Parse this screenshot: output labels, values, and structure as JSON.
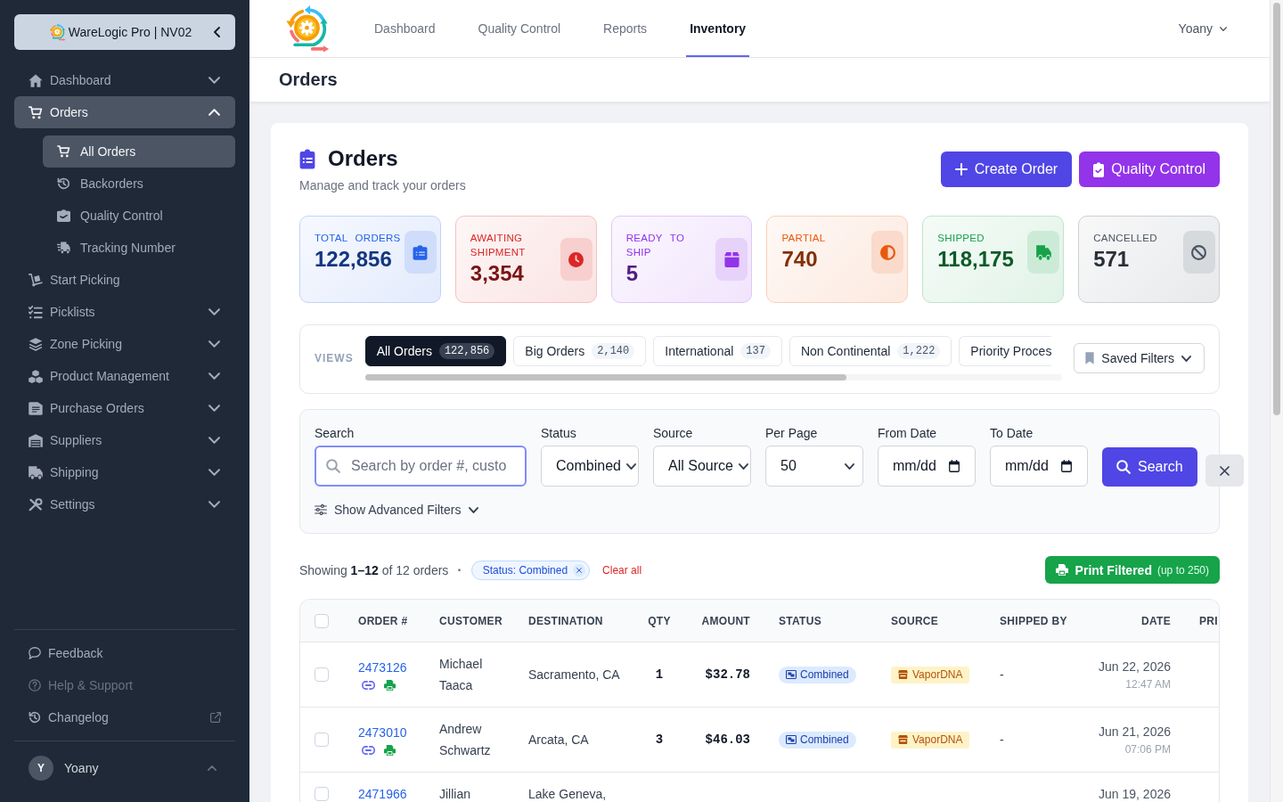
{
  "sidebar": {
    "brand": "WareLogic Pro | NV02",
    "items": [
      {
        "kind": "group",
        "label": "Dashboard",
        "selected": false,
        "expanded": false
      },
      {
        "kind": "group",
        "label": "Orders",
        "selected": true,
        "expanded": true,
        "children": [
          {
            "label": "All Orders",
            "selected": true
          },
          {
            "label": "Backorders",
            "selected": false
          },
          {
            "label": "Quality Control",
            "selected": false
          },
          {
            "label": "Tracking Number",
            "selected": false
          }
        ]
      },
      {
        "kind": "link",
        "label": "Start Picking",
        "selected": false
      },
      {
        "kind": "group",
        "label": "Picklists",
        "selected": false,
        "expanded": false
      },
      {
        "kind": "group",
        "label": "Zone Picking",
        "selected": false,
        "expanded": false
      },
      {
        "kind": "group",
        "label": "Product Management",
        "selected": false,
        "expanded": false
      },
      {
        "kind": "group",
        "label": "Purchase Orders",
        "selected": false,
        "expanded": false
      },
      {
        "kind": "group",
        "label": "Suppliers",
        "selected": false,
        "expanded": false
      },
      {
        "kind": "group",
        "label": "Shipping",
        "selected": false,
        "expanded": false
      },
      {
        "kind": "group",
        "label": "Settings",
        "selected": false,
        "expanded": false
      }
    ],
    "footer_items": [
      {
        "label": "Feedback",
        "disabled": false,
        "external": false
      },
      {
        "label": "Help & Support",
        "disabled": true,
        "external": false
      },
      {
        "label": "Changelog",
        "disabled": false,
        "external": true
      }
    ],
    "user": {
      "initial": "Y",
      "name": "Yoany"
    }
  },
  "top_nav": {
    "links": [
      {
        "label": "Dashboard",
        "selected": false
      },
      {
        "label": "Quality Control",
        "selected": false
      },
      {
        "label": "Reports",
        "selected": false
      },
      {
        "label": "Inventory",
        "selected": true
      }
    ],
    "user": "Yoany"
  },
  "page_title": "Orders",
  "header": {
    "title": "Orders",
    "subtitle": "Manage and track your orders",
    "buttons": [
      {
        "kind": "primary",
        "label": "Create Order"
      },
      {
        "kind": "secondary",
        "label": "Quality Control"
      }
    ]
  },
  "stats": [
    {
      "label": "TOTAL ORDERS",
      "value": "122,856",
      "color": "#2563eb"
    },
    {
      "label": "AWAITING SHIPMENT",
      "value": "3,354",
      "color": "#dc2626"
    },
    {
      "label": "READY TO SHIP",
      "value": "5",
      "color": "#9333ea"
    },
    {
      "label": "PARTIAL",
      "value": "740",
      "color": "#ea580c"
    },
    {
      "label": "SHIPPED",
      "value": "118,175",
      "color": "#16a34a"
    },
    {
      "label": "CANCELLED",
      "value": "571",
      "color": "#4b5563"
    }
  ],
  "views": {
    "label": "VIEWS",
    "tabs": [
      {
        "label": "All Orders",
        "count": "122,856",
        "selected": true
      },
      {
        "label": "Big Orders",
        "count": "2,140",
        "selected": false
      },
      {
        "label": "International",
        "count": "137",
        "selected": false
      },
      {
        "label": "Non Continental",
        "count": "1,222",
        "selected": false
      },
      {
        "label": "Priority Proces",
        "selected": false
      }
    ],
    "saved_filters": "Saved Filters"
  },
  "filters": {
    "fields": [
      {
        "kind": "search",
        "label": "Search",
        "placeholder": "Search by order #, custo",
        "focused": true
      },
      {
        "kind": "select",
        "label": "Status",
        "value": "Combined"
      },
      {
        "kind": "select",
        "label": "Source",
        "value": "All Source"
      },
      {
        "kind": "select",
        "label": "Per Page",
        "value": "50"
      },
      {
        "kind": "date",
        "label": "From Date",
        "placeholder": "mm/dd"
      },
      {
        "kind": "date",
        "label": "To Date",
        "placeholder": "mm/dd"
      }
    ],
    "search_button": "Search",
    "advanced_toggle": "Show Advanced Filters"
  },
  "results": {
    "summary": "Showing **1–12** of 12 orders",
    "separator": "·",
    "chips": [
      {
        "label": "Status: Combined"
      }
    ],
    "clear": "Clear all",
    "print_button": {
      "label": "Print Filtered",
      "note": "(up to 250)"
    }
  },
  "table": {
    "select_all": {
      "checked": false
    },
    "columns": [
      "ORDER #",
      "CUSTOMER",
      "DESTINATION",
      "QTY",
      "AMOUNT",
      "STATUS",
      "SOURCE",
      "SHIPPED BY",
      "DATE",
      "PRI"
    ],
    "rows": [
      {
        "selected": false,
        "order": "2473126",
        "customer": "Michael Taaca",
        "destination": "Sacramento, CA",
        "qty": "1",
        "amount": "$32.78",
        "status": "Combined",
        "source": "VaporDNA",
        "shipped_by": "-",
        "date": "Jun 22, 2026",
        "time": "12:47 AM"
      },
      {
        "selected": false,
        "order": "2473010",
        "customer": "Andrew Schwartz",
        "destination": "Arcata, CA",
        "qty": "3",
        "amount": "$46.03",
        "status": "Combined",
        "source": "VaporDNA",
        "shipped_by": "-",
        "date": "Jun 21, 2026",
        "time": "07:06 PM"
      },
      {
        "selected": false,
        "order": "2471966",
        "customer": "Jillian",
        "destination": "Lake Geneva,",
        "date": "Jun 19, 2026"
      }
    ]
  }
}
